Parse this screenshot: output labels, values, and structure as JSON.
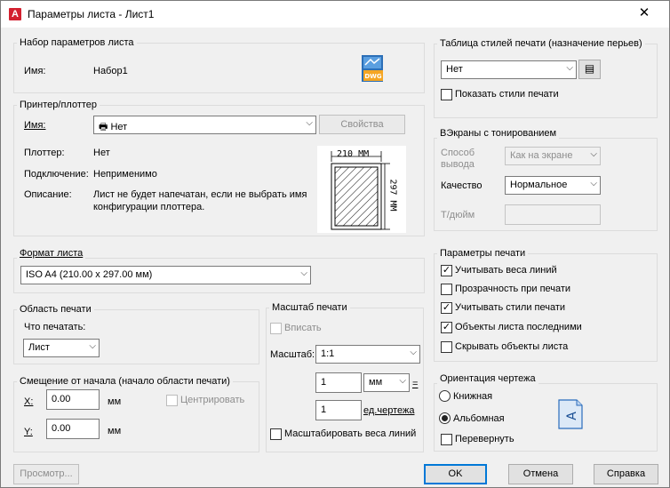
{
  "window": {
    "title": "Параметры листа - Лист1",
    "app_icon": "A"
  },
  "preset": {
    "group": "Набор параметров листа",
    "name_label": "Имя:",
    "name_value": "Набор1",
    "icon_label": "DWG"
  },
  "printer": {
    "group": "Принтер/плоттер",
    "name_label": "Имя:",
    "name_value": "Нет",
    "properties_button": "Свойства",
    "plotter_label": "Плоттер:",
    "plotter_value": "Нет",
    "connection_label": "Подключение:",
    "connection_value": "Неприменимо",
    "description_label": "Описание:",
    "description_line1": "Лист не будет напечатан, если не выбрать имя",
    "description_line2": "конфигурации плоттера.",
    "preview_width": "210 ММ",
    "preview_height": "297 ММ"
  },
  "paper": {
    "group": "Формат листа",
    "value": "ISO A4 (210.00 x 297.00 мм)"
  },
  "area": {
    "group": "Область печати",
    "what_label": "Что печатать:",
    "what_value": "Лист"
  },
  "offset": {
    "group": "Смещение от начала (начало области печати)",
    "x_label": "X:",
    "x_value": "0.00",
    "x_unit": "мм",
    "y_label": "Y:",
    "y_value": "0.00",
    "y_unit": "мм",
    "center_label": "Центрировать"
  },
  "scale": {
    "group": "Масштаб печати",
    "fit_label": "Вписать",
    "scale_label": "Масштаб:",
    "scale_value": "1:1",
    "value1": "1",
    "unit1": "мм",
    "equals": "=",
    "value2": "1",
    "unit2": "ед.чертежа",
    "lineweights_label": "Масштабировать веса линий"
  },
  "styles": {
    "group": "Таблица стилей печати (назначение перьев)",
    "value": "Нет",
    "show_label": "Показать стили печати"
  },
  "shaded": {
    "group": "ВЭкраны с тонированием",
    "method_label1": "Способ",
    "method_label2": "вывода",
    "method_value": "Как на экране",
    "quality_label": "Качество",
    "quality_value": "Нормальное",
    "dpi_label": "Т/дюйм",
    "dpi_value": ""
  },
  "options": {
    "group": "Параметры печати",
    "items": [
      {
        "label": "Учитывать веса линий",
        "checked": true
      },
      {
        "label": "Прозрачность при печати",
        "checked": false
      },
      {
        "label": "Учитывать стили печати",
        "checked": true
      },
      {
        "label": "Объекты листа последними",
        "checked": true
      },
      {
        "label": "Скрывать объекты листа",
        "checked": false
      }
    ]
  },
  "orientation": {
    "group": "Ориентация чертежа",
    "portrait": "Книжная",
    "landscape": "Альбомная",
    "upside": "Перевернуть",
    "icon_label": "A"
  },
  "buttons": {
    "preview": "Просмотр...",
    "ok": "OK",
    "cancel": "Отмена",
    "help": "Справка"
  }
}
